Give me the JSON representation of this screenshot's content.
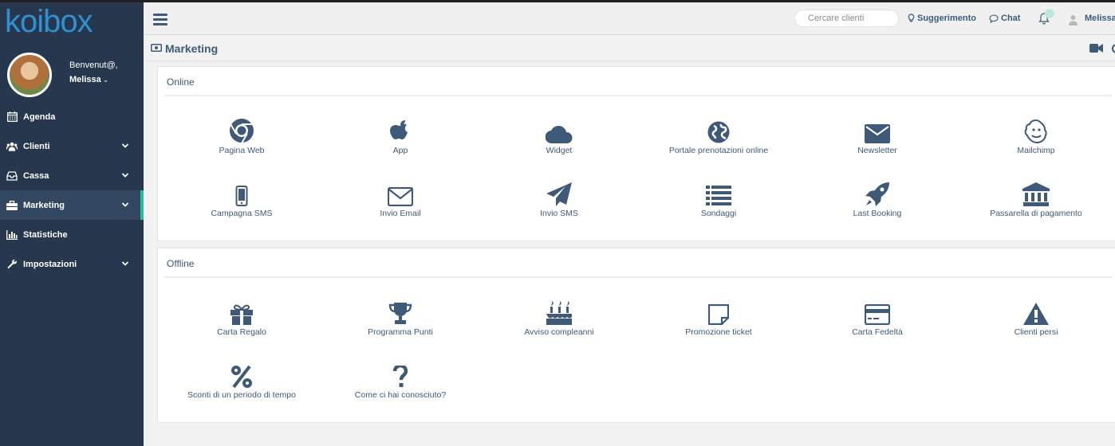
{
  "app": {
    "logo_text": "koibox"
  },
  "colors": {
    "sidebar_bg": "#27384e",
    "accent": "#2bbf95",
    "icon": "#3e5a78",
    "logo": "#2f8fd0"
  },
  "sidebar": {
    "welcome": "Benvenut@,",
    "user": "Melissa",
    "items": [
      {
        "label": "Agenda",
        "icon": "calendar-icon",
        "has_submenu": false
      },
      {
        "label": "Clienti",
        "icon": "users-icon",
        "has_submenu": true
      },
      {
        "label": "Cassa",
        "icon": "cash-drawer-icon",
        "has_submenu": true
      },
      {
        "label": "Marketing",
        "icon": "briefcase-icon",
        "has_submenu": true,
        "active": true
      },
      {
        "label": "Statistiche",
        "icon": "bar-chart-icon",
        "has_submenu": false
      },
      {
        "label": "Impostazioni",
        "icon": "wrench-icon",
        "has_submenu": true
      }
    ]
  },
  "topbar": {
    "search_placeholder": "Cercare clienti",
    "suggest_label": "Suggerimento",
    "chat_label": "Chat",
    "user": "Melissa"
  },
  "page": {
    "title": "Marketing"
  },
  "sections": {
    "online": {
      "title": "Online",
      "items": [
        {
          "label": "Pagina Web",
          "icon": "chrome-icon"
        },
        {
          "label": "App",
          "icon": "apple-icon"
        },
        {
          "label": "Widget",
          "icon": "cloud-icon"
        },
        {
          "label": "Portale prenotazioni online",
          "icon": "globe-icon"
        },
        {
          "label": "Newsletter",
          "icon": "envelope-icon"
        },
        {
          "label": "Mailchimp",
          "icon": "mailchimp-icon"
        },
        {
          "label": "Campagna SMS",
          "icon": "mobile-icon"
        },
        {
          "label": "Invio Email",
          "icon": "envelope-outline-icon"
        },
        {
          "label": "Invio SMS",
          "icon": "paper-plane-icon"
        },
        {
          "label": "Sondaggi",
          "icon": "list-icon"
        },
        {
          "label": "Last Booking",
          "icon": "rocket-icon"
        },
        {
          "label": "Passarella di pagamento",
          "icon": "bank-icon"
        }
      ]
    },
    "offline": {
      "title": "Offline",
      "items": [
        {
          "label": "Carta Regalo",
          "icon": "gift-icon"
        },
        {
          "label": "Programma Punti",
          "icon": "trophy-icon"
        },
        {
          "label": "Avviso compleanni",
          "icon": "birthday-cake-icon"
        },
        {
          "label": "Promozione ticket",
          "icon": "sticky-note-icon"
        },
        {
          "label": "Carta Fedeltà",
          "icon": "credit-card-icon"
        },
        {
          "label": "Clienti persi",
          "icon": "warning-icon"
        },
        {
          "label": "Sconti di un periodo di tempo",
          "icon": "percent-icon"
        },
        {
          "label": "Come ci hai conosciuto?",
          "icon": "question-icon"
        }
      ]
    }
  }
}
